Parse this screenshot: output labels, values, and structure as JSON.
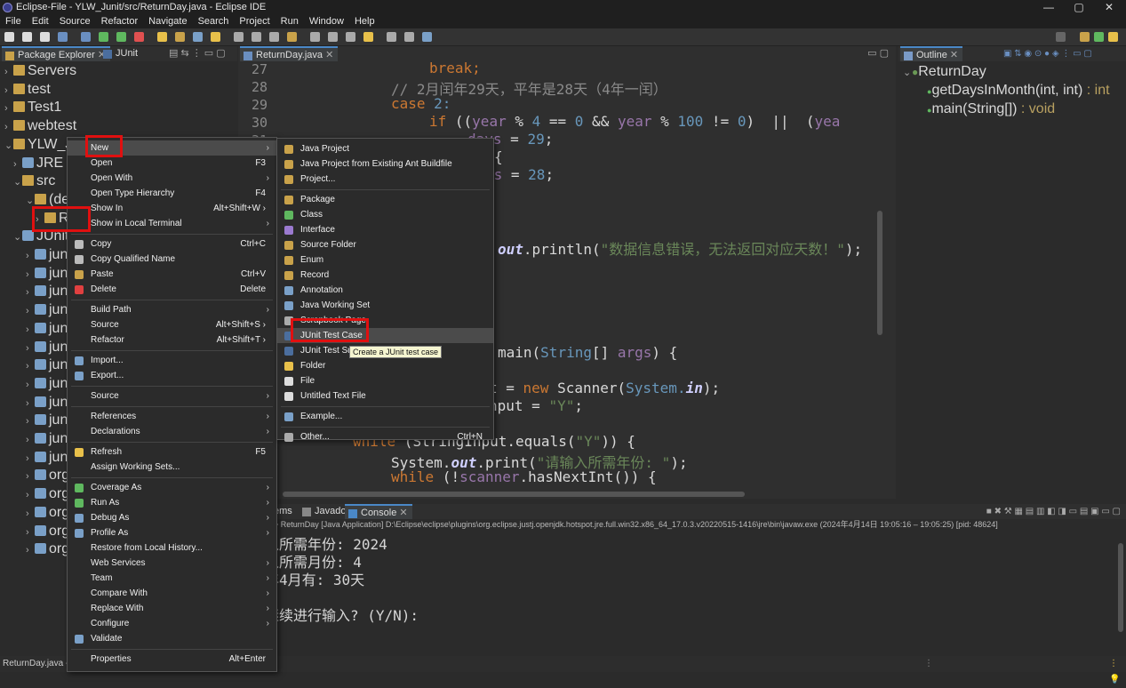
{
  "window": {
    "title": "Eclipse-File - YLW_Junit/src/ReturnDay.java - Eclipse IDE",
    "controls": [
      "—",
      "▢",
      "✕"
    ]
  },
  "menu": [
    "File",
    "Edit",
    "Source",
    "Refactor",
    "Navigate",
    "Search",
    "Project",
    "Run",
    "Window",
    "Help"
  ],
  "left_tabs": {
    "package_explorer": "Package Explorer",
    "junit": "JUnit"
  },
  "tree": [
    {
      "label": "Servers",
      "chev": "›"
    },
    {
      "label": "test",
      "chev": "›"
    },
    {
      "label": "Test1",
      "chev": "›"
    },
    {
      "label": "webtest",
      "chev": "›"
    },
    {
      "label": "YLW_Ju",
      "chev": "⌄"
    },
    {
      "label": "JRE S",
      "chev": "›"
    },
    {
      "label": "src",
      "chev": "⌄"
    },
    {
      "label": "(de",
      "chev": "⌄"
    },
    {
      "label": "R",
      "chev": "›"
    },
    {
      "label": "JUnit",
      "chev": "⌄"
    },
    {
      "label": "jun",
      "chev": "›"
    },
    {
      "label": "jun",
      "chev": "›"
    },
    {
      "label": "jun",
      "chev": "›"
    },
    {
      "label": "jun",
      "chev": "›"
    },
    {
      "label": "jun",
      "chev": "›"
    },
    {
      "label": "jun",
      "chev": "›"
    },
    {
      "label": "jun",
      "chev": "›"
    },
    {
      "label": "jun",
      "chev": "›"
    },
    {
      "label": "jun",
      "chev": "›"
    },
    {
      "label": "jun",
      "chev": "›"
    },
    {
      "label": "jun",
      "chev": "›"
    },
    {
      "label": "jun",
      "chev": "›"
    },
    {
      "label": "org",
      "chev": "›"
    },
    {
      "label": "org",
      "chev": "›"
    },
    {
      "label": "org",
      "chev": "›"
    },
    {
      "label": "org",
      "chev": "›"
    },
    {
      "label": "org",
      "chev": "›"
    }
  ],
  "editor": {
    "tab": "ReturnDay.java",
    "line_numbers": [
      "27",
      "28",
      "29",
      "30",
      "31"
    ],
    "code": {
      "l27": "break;",
      "l28": "// 2月闰年29天，平年是28天（4年一闰）",
      "l29_kw": "case",
      "l29_num": "2:",
      "l30_kw": "if",
      "l30_a": " ((",
      "l30_var1": "year",
      "l30_b": " % ",
      "l30_n4": "4",
      "l30_c": " == ",
      "l30_n0": "0",
      "l30_d": " && ",
      "l30_var2": "year",
      "l30_e": " % ",
      "l30_n100": "100",
      "l30_f": " != ",
      "l30_n0b": "0",
      "l30_g": ")  ||  (",
      "l30_var3": "yea",
      "l31_var": "days",
      "l31_rest": " = ",
      "l31_num": "29",
      "l31_end": ";",
      "l32": "{",
      "l33_var": "ys",
      "l33_rest": " = ",
      "l33_num": "28",
      "l33_end": ";",
      "l_print_fld": "out",
      "l_print_rest": ".println(",
      "l_print_str": "\"数据信息错误，无法返回对应天数！\"",
      "l_print_end": ");",
      "l_main_fn": "main(",
      "l_main_typ": "String",
      "l_main_rest": "[] ",
      "l_main_var": "args",
      ") {": "",
      "l_main_end": ") {",
      "l_scan_a": "t = ",
      "l_scan_kw": "new",
      "l_scan_b": " Scanner(",
      "l_scan_typ": "System.",
      "l_scan_fld": "in",
      "l_scan_end": ");",
      "l_inp_a": "nput = ",
      "l_inp_str": "\"Y\"",
      "l_inp_end": ";",
      "l_while1_kw": "while",
      "l_while1_a": " (StringInput.equals(",
      "l_while1_str": "\"Y\"",
      "l_while1_end": ")) {",
      "l_sys_a": "System.",
      "l_sys_fld": "out",
      "l_sys_b": ".print(",
      "l_sys_str": "\"请输入所需年份: \"",
      "l_sys_end": ");",
      "l_while2_kw": "while",
      "l_while2_a": " (!",
      "l_while2_var": "scanner",
      ".hasNextInt()) {": "",
      "l_while2_end": ".hasNextInt()) {"
    }
  },
  "outline": {
    "tab": "Outline",
    "class_name": "ReturnDay",
    "methods": [
      {
        "name": "getDaysInMonth(int, int)",
        "ret": " : int"
      },
      {
        "name": "main(String[])",
        "ret": " : void"
      }
    ]
  },
  "console": {
    "tabs": [
      "ems",
      "Javadoc",
      "Console"
    ],
    "header": "ed> ReturnDay [Java Application] D:\\Eclipse\\eclipse\\plugins\\org.eclipse.justj.openjdk.hotspot.jre.full.win32.x86_64_17.0.3.v20220515-1416\\jre\\bin\\javaw.exe  (2024年4月14日 19:05:16 – 19:05:25) [pid: 48624]",
    "lines": [
      "入所需年份: 2024",
      "入所需月份: 4",
      "年4月有: 30天",
      "",
      "继续进行输入? (Y/N):"
    ]
  },
  "context_menu": [
    {
      "label": "New",
      "arrow": "›",
      "highlighted": true
    },
    {
      "label": "Open",
      "shortcut": "F3"
    },
    {
      "label": "Open With",
      "arrow": "›"
    },
    {
      "label": "Open Type Hierarchy",
      "shortcut": "F4"
    },
    {
      "label": "Show In",
      "shortcut": "Alt+Shift+W ›"
    },
    {
      "label": "Show in Local Terminal",
      "arrow": "›"
    },
    {
      "sep": true
    },
    {
      "label": "Copy",
      "shortcut": "Ctrl+C",
      "icon": "copy-icon"
    },
    {
      "label": "Copy Qualified Name",
      "icon": "copy-icon"
    },
    {
      "label": "Paste",
      "shortcut": "Ctrl+V",
      "icon": "paste-icon"
    },
    {
      "label": "Delete",
      "shortcut": "Delete",
      "icon": "delete-icon"
    },
    {
      "sep": true
    },
    {
      "label": "Build Path",
      "arrow": "›"
    },
    {
      "label": "Source",
      "shortcut": "Alt+Shift+S ›"
    },
    {
      "label": "Refactor",
      "shortcut": "Alt+Shift+T ›"
    },
    {
      "sep": true
    },
    {
      "label": "Import...",
      "icon": "import-icon"
    },
    {
      "label": "Export...",
      "icon": "export-icon"
    },
    {
      "sep": true
    },
    {
      "label": "Source",
      "arrow": "›"
    },
    {
      "sep": true
    },
    {
      "label": "References",
      "arrow": "›"
    },
    {
      "label": "Declarations",
      "arrow": "›"
    },
    {
      "sep": true
    },
    {
      "label": "Refresh",
      "shortcut": "F5",
      "icon": "refresh-icon"
    },
    {
      "label": "Assign Working Sets..."
    },
    {
      "sep": true
    },
    {
      "label": "Coverage As",
      "arrow": "›",
      "icon": "coverage-icon"
    },
    {
      "label": "Run As",
      "arrow": "›",
      "icon": "run-icon"
    },
    {
      "label": "Debug As",
      "arrow": "›",
      "icon": "debug-icon"
    },
    {
      "label": "Profile As",
      "arrow": "›",
      "icon": "profile-icon"
    },
    {
      "label": "Restore from Local History..."
    },
    {
      "label": "Web Services",
      "arrow": "›"
    },
    {
      "label": "Team",
      "arrow": "›"
    },
    {
      "label": "Compare With",
      "arrow": "›"
    },
    {
      "label": "Replace With",
      "arrow": "›"
    },
    {
      "label": "Configure",
      "arrow": "›"
    },
    {
      "label": "Validate",
      "icon": "validate-icon"
    },
    {
      "sep": true
    },
    {
      "label": "Properties",
      "shortcut": "Alt+Enter"
    }
  ],
  "submenu": [
    {
      "label": "Java Project",
      "icon": "java-project-icon"
    },
    {
      "label": "Java Project from Existing Ant Buildfile",
      "icon": "ant-icon"
    },
    {
      "label": "Project...",
      "icon": "project-icon"
    },
    {
      "sep": true
    },
    {
      "label": "Package",
      "icon": "package-icon"
    },
    {
      "label": "Class",
      "icon": "class-icon"
    },
    {
      "label": "Interface",
      "icon": "interface-icon"
    },
    {
      "label": "Source Folder",
      "icon": "source-folder-icon"
    },
    {
      "label": "Enum",
      "icon": "enum-icon"
    },
    {
      "label": "Record",
      "icon": "record-icon"
    },
    {
      "label": "Annotation",
      "icon": "annotation-icon"
    },
    {
      "label": "Java Working Set",
      "icon": "working-set-icon"
    },
    {
      "label": "Scrapbook Page",
      "icon": "scrapbook-icon"
    },
    {
      "label": "JUnit Test Case",
      "icon": "junit-test-case-icon",
      "highlighted": true
    },
    {
      "label": "JUnit Test Suite",
      "icon": "junit-suite-icon"
    },
    {
      "label": "Folder",
      "icon": "folder-icon"
    },
    {
      "label": "File",
      "icon": "file-icon"
    },
    {
      "label": "Untitled Text File",
      "icon": "text-file-icon"
    },
    {
      "sep": true
    },
    {
      "label": "Example...",
      "icon": "example-icon"
    },
    {
      "sep": true
    },
    {
      "label": "Other...",
      "shortcut": "Ctrl+N",
      "icon": "other-icon"
    }
  ],
  "tooltip": "Create a JUnit test case",
  "status": {
    "left": "ReturnDay.java -"
  },
  "colors": {
    "highlight_box": "#e01010",
    "background": "#2b2b2b",
    "keyword": "#cc7832",
    "string": "#6a8759",
    "number": "#6897bb"
  }
}
